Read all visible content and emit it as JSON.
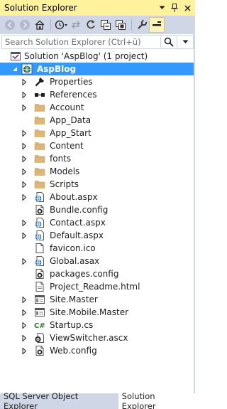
{
  "window": {
    "title": "Solution Explorer",
    "title_buttons": [
      "dropdown-icon",
      "pin-icon",
      "close-icon"
    ]
  },
  "toolbar": {
    "tools": [
      "back-icon",
      "forward-icon",
      "home-icon",
      "history-icon",
      "sync-icon",
      "collapse-all-icon",
      "show-all-files-icon",
      "refresh-icon",
      "properties-icon",
      "preview-icon"
    ]
  },
  "search": {
    "placeholder": "Search Solution Explorer (Ctrl+ü)"
  },
  "tree": {
    "solution": "Solution 'AspBlog' (1 project)",
    "project": "AspBlog",
    "items": [
      {
        "label": "Properties",
        "icon": "wrench-icon",
        "expandable": true
      },
      {
        "label": "References",
        "icon": "references-icon",
        "expandable": true
      },
      {
        "label": "Account",
        "icon": "folder-icon",
        "expandable": true
      },
      {
        "label": "App_Data",
        "icon": "folder-icon",
        "expandable": false
      },
      {
        "label": "App_Start",
        "icon": "folder-icon",
        "expandable": true
      },
      {
        "label": "Content",
        "icon": "folder-icon",
        "expandable": true
      },
      {
        "label": "fonts",
        "icon": "folder-icon",
        "expandable": true
      },
      {
        "label": "Models",
        "icon": "folder-icon",
        "expandable": true
      },
      {
        "label": "Scripts",
        "icon": "folder-icon",
        "expandable": true
      },
      {
        "label": "About.aspx",
        "icon": "web-page-icon",
        "expandable": true
      },
      {
        "label": "Bundle.config",
        "icon": "config-file-icon",
        "expandable": false
      },
      {
        "label": "Contact.aspx",
        "icon": "web-page-icon",
        "expandable": true
      },
      {
        "label": "Default.aspx",
        "icon": "web-page-icon",
        "expandable": true
      },
      {
        "label": "favicon.ico",
        "icon": "ico-file-icon",
        "expandable": false
      },
      {
        "label": "Global.asax",
        "icon": "web-page-icon",
        "expandable": true
      },
      {
        "label": "packages.config",
        "icon": "config-file-icon",
        "expandable": false
      },
      {
        "label": "Project_Readme.html",
        "icon": "html-file-icon",
        "expandable": false
      },
      {
        "label": "Site.Master",
        "icon": "master-page-icon",
        "expandable": true
      },
      {
        "label": "Site.Mobile.Master",
        "icon": "master-page-icon",
        "expandable": true
      },
      {
        "label": "Startup.cs",
        "icon": "csharp-file-icon",
        "expandable": true
      },
      {
        "label": "ViewSwitcher.ascx",
        "icon": "user-control-icon",
        "expandable": true
      },
      {
        "label": "Web.config",
        "icon": "config-file-icon",
        "expandable": true
      }
    ]
  },
  "tabs": [
    {
      "label": "SQL Server Object Explorer",
      "active": false
    },
    {
      "label": "Solution Explorer",
      "active": true
    }
  ],
  "colors": {
    "title_bar": "#fff29d",
    "toolbar": "#cfd6e5",
    "selection": "#3399ff",
    "folder": "#dcb67a"
  }
}
